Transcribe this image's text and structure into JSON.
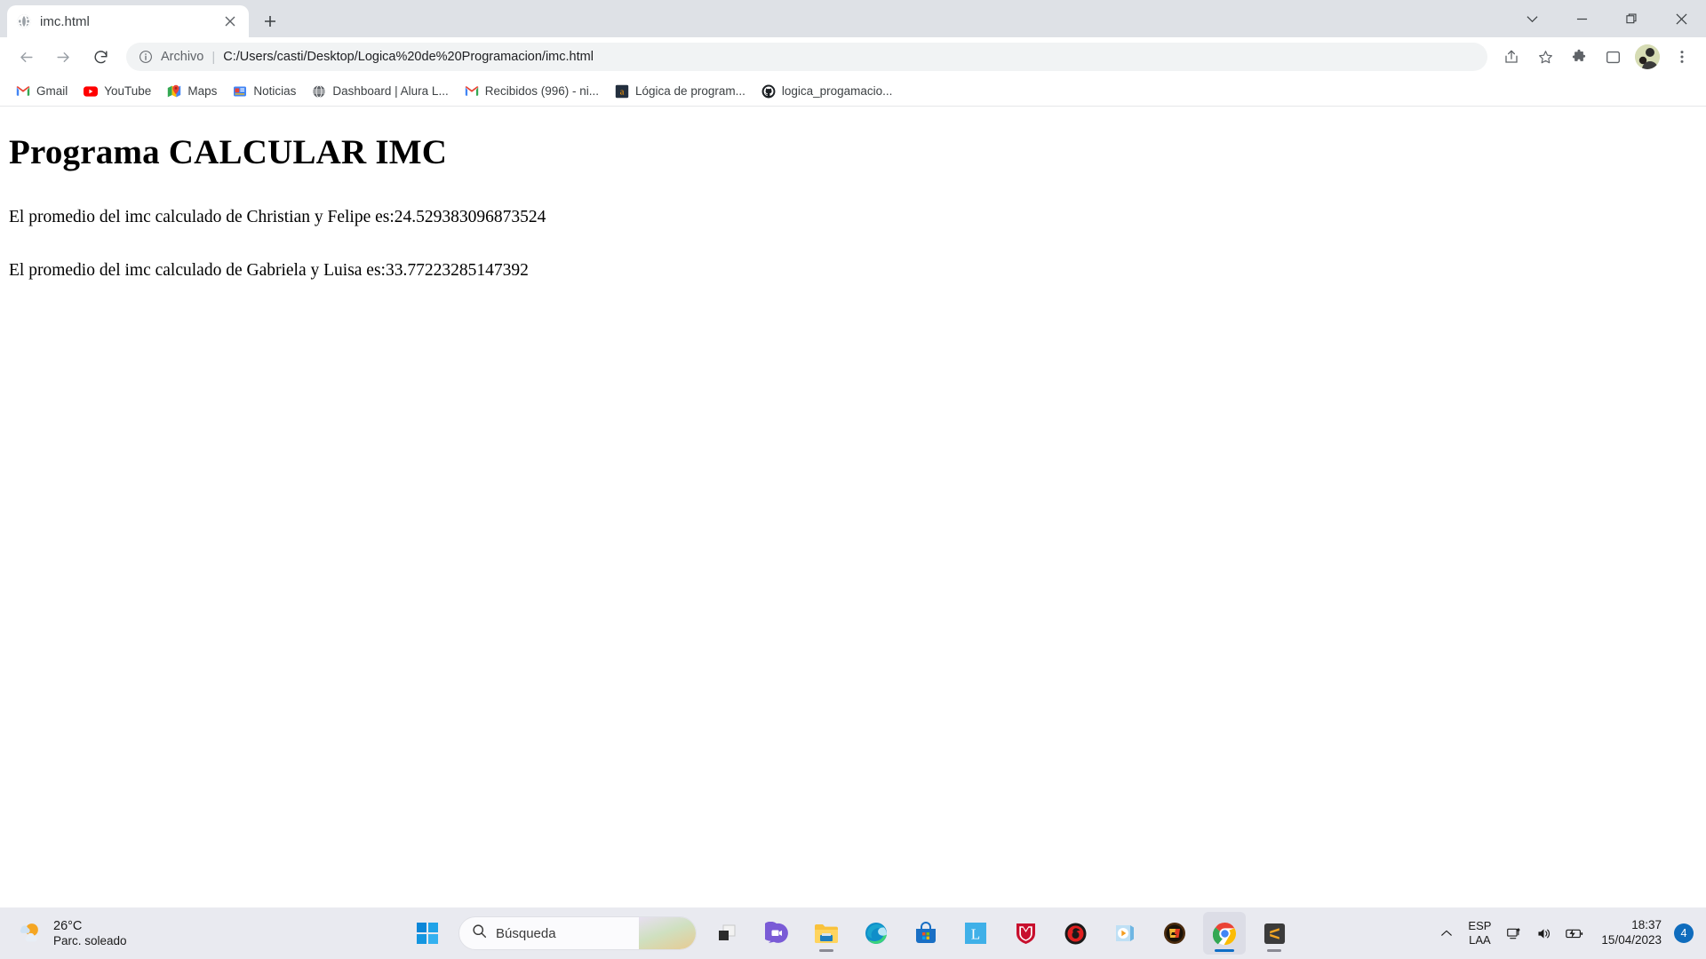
{
  "window": {
    "controls": {
      "tab_search": "chevron-down",
      "minimize": "minimize",
      "maximize": "restore",
      "close": "close"
    }
  },
  "tabstrip": {
    "tabs": [
      {
        "title": "imc.html",
        "favicon": "globe-icon",
        "active": true
      }
    ],
    "new_tab_label": "+"
  },
  "toolbar": {
    "back": "back-icon",
    "forward": "forward-icon",
    "reload": "reload-icon",
    "omnibox": {
      "info_icon": "info-circle-icon",
      "scheme_label": "Archivo",
      "separator": "|",
      "url": "C:/Users/casti/Desktop/Logica%20de%20Programacion/imc.html"
    },
    "share": "share-icon",
    "bookmark_star": "star-icon",
    "extensions": "puzzle-icon",
    "side_panel": "side-panel-icon",
    "profile": "avatar",
    "menu": "three-dots-icon"
  },
  "bookmarks": {
    "items": [
      {
        "label": "Gmail",
        "icon": "gmail-icon"
      },
      {
        "label": "YouTube",
        "icon": "youtube-icon"
      },
      {
        "label": "Maps",
        "icon": "maps-icon"
      },
      {
        "label": "Noticias",
        "icon": "news-icon"
      },
      {
        "label": "Dashboard | Alura L...",
        "icon": "globe-icon"
      },
      {
        "label": "Recibidos (996) - ni...",
        "icon": "gmail-icon"
      },
      {
        "label": "Lógica de program...",
        "icon": "amazon-icon"
      },
      {
        "label": "logica_progamacio...",
        "icon": "github-icon"
      }
    ]
  },
  "page": {
    "heading": "Programa CALCULAR IMC",
    "paragraphs": [
      "El promedio del imc calculado de Christian y Felipe es:24.529383096873524",
      "El promedio del imc calculado de Gabriela y Luisa es:33.77223285147392"
    ]
  },
  "taskbar": {
    "weather": {
      "temperature": "26°C",
      "condition": "Parc. soleado",
      "icon": "partly-sunny-icon"
    },
    "start_button": "windows-logo-icon",
    "search": {
      "icon": "search-icon",
      "placeholder": "Búsqueda"
    },
    "apps": [
      {
        "name": "task-view",
        "icon": "task-view-icon",
        "active": false,
        "running": false
      },
      {
        "name": "chat",
        "icon": "chat-icon",
        "active": false,
        "running": false
      },
      {
        "name": "file-explorer",
        "icon": "folder-icon",
        "active": false,
        "running": true
      },
      {
        "name": "edge",
        "icon": "edge-icon",
        "active": false,
        "running": false
      },
      {
        "name": "microsoft-store",
        "icon": "store-icon",
        "active": false,
        "running": false
      },
      {
        "name": "app-l",
        "icon": "letter-l-icon",
        "active": false,
        "running": false
      },
      {
        "name": "mcafee",
        "icon": "shield-icon",
        "active": false,
        "running": false
      },
      {
        "name": "gameloop",
        "icon": "red-circle-icon",
        "active": false,
        "running": false
      },
      {
        "name": "media-player",
        "icon": "play-icon",
        "active": false,
        "running": false
      },
      {
        "name": "crossfire",
        "icon": "crossfire-icon",
        "active": false,
        "running": false
      },
      {
        "name": "chrome",
        "icon": "chrome-icon",
        "active": true,
        "running": true
      },
      {
        "name": "sublime-text",
        "icon": "sublime-icon",
        "active": false,
        "running": true
      }
    ],
    "tray": {
      "overflow": "chevron-up-icon",
      "language_line1": "ESP",
      "language_line2": "LAA",
      "network": "network-icon",
      "volume": "volume-icon",
      "battery": "battery-charging-icon",
      "time": "18:37",
      "date": "15/04/2023",
      "notification_count": "4"
    }
  },
  "colors": {
    "tabstrip_bg": "#dee1e6",
    "toolbar_bg": "#ffffff",
    "omnibox_bg": "#f1f3f4",
    "taskbar_bg": "#e9eaf0",
    "accent_blue": "#0f6cbd"
  }
}
